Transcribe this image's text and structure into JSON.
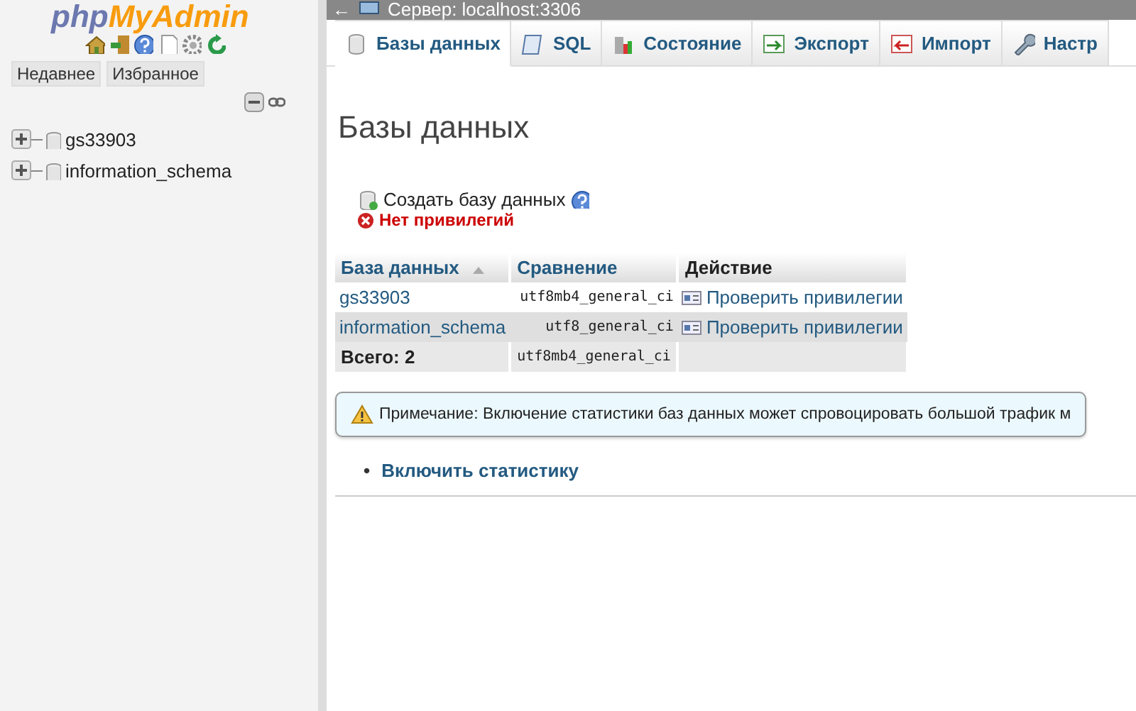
{
  "sidebar": {
    "logo": {
      "part_1": "php",
      "part_2": "MyAdmin"
    },
    "tabs": [
      {
        "label": "Недавнее"
      },
      {
        "label": "Избранное"
      }
    ],
    "tree": [
      {
        "label": "gs33903",
        "expanded": false
      },
      {
        "label": "information_schema",
        "expanded": false
      }
    ]
  },
  "server_bar": {
    "back": "←",
    "title": "Сервер: localhost:3306"
  },
  "tabs": [
    {
      "label": "Базы данных",
      "selected": true
    },
    {
      "label": "SQL",
      "selected": false
    },
    {
      "label": "Состояние",
      "selected": false
    },
    {
      "label": "Экспорт",
      "selected": false
    },
    {
      "label": "Импорт",
      "selected": false
    },
    {
      "label": "Настр",
      "selected": false
    }
  ],
  "heading": "Базы данных",
  "create_db": {
    "label": "Создать базу данных",
    "error": "Нет привилегий"
  },
  "table": {
    "columns": [
      "База данных",
      "Сравнение",
      "Действие"
    ],
    "rows": [
      {
        "name": "gs33903",
        "collation": "utf8mb4_general_ci",
        "action": "Проверить привилегии"
      },
      {
        "name": "information_schema",
        "collation": "utf8_general_ci",
        "action": "Проверить привилегии"
      }
    ],
    "footer": {
      "label": "Всего: 2",
      "collation": "utf8mb4_general_ci"
    }
  },
  "notice": "Примечание: Включение статистики баз данных может спровоцировать большой трафик м",
  "links": [
    {
      "bullet": "•",
      "label": "Включить статистику"
    }
  ]
}
